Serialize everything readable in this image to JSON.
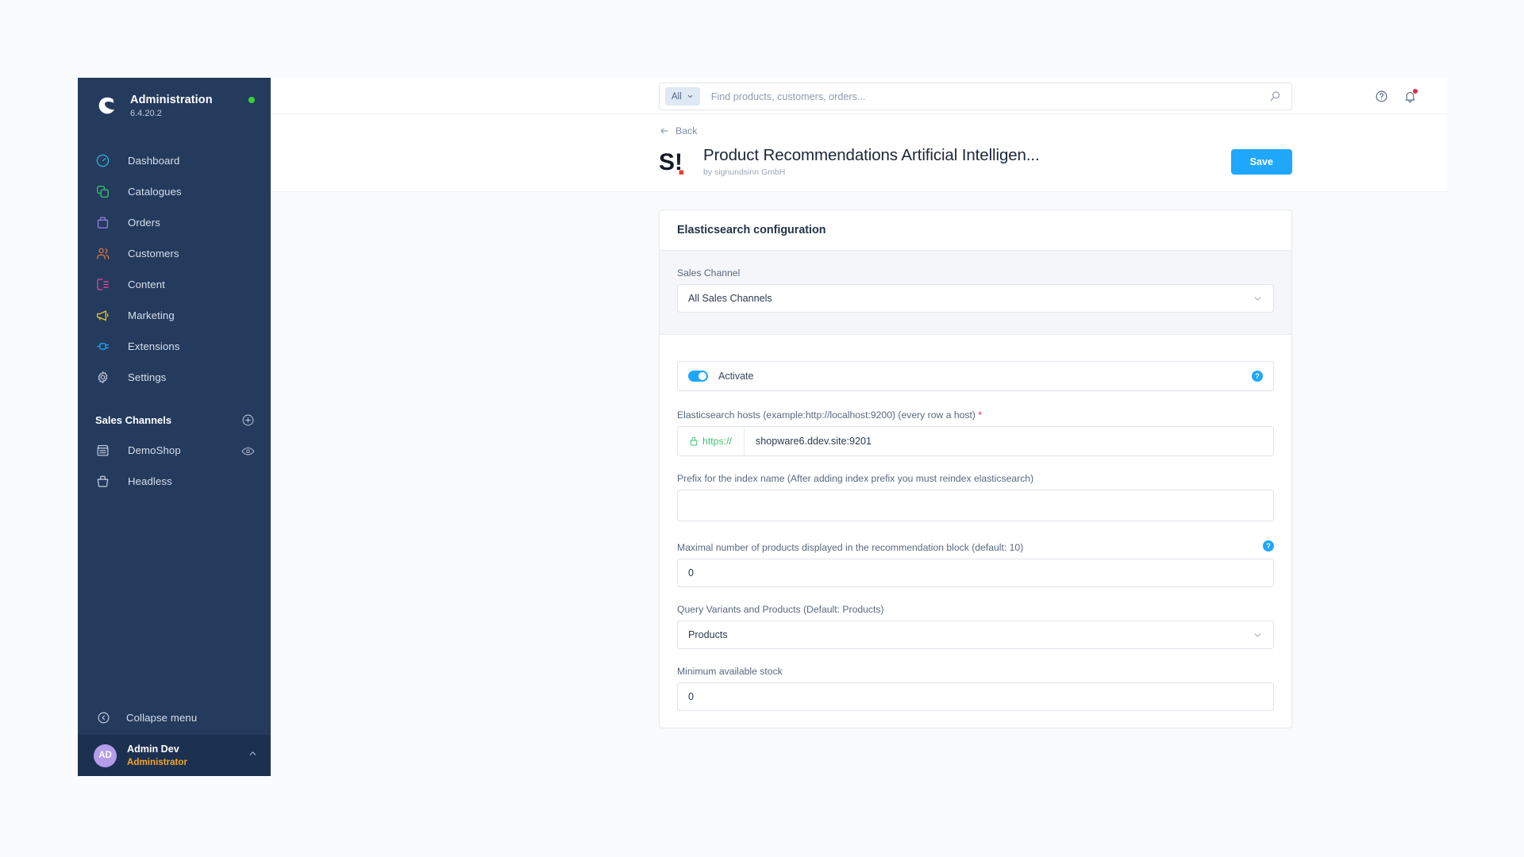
{
  "sidebar": {
    "brand": {
      "title": "Administration",
      "version": "6.4.20.2"
    },
    "nav": [
      {
        "label": "Dashboard",
        "icon": "speedometer-icon"
      },
      {
        "label": "Catalogues",
        "icon": "layers-icon"
      },
      {
        "label": "Orders",
        "icon": "bag-icon"
      },
      {
        "label": "Customers",
        "icon": "users-icon"
      },
      {
        "label": "Content",
        "icon": "content-icon"
      },
      {
        "label": "Marketing",
        "icon": "megaphone-icon"
      },
      {
        "label": "Extensions",
        "icon": "plug-icon"
      },
      {
        "label": "Settings",
        "icon": "gear-icon"
      }
    ],
    "sales_channels": {
      "label": "Sales Channels",
      "add_icon": "plus-circle-icon",
      "items": [
        {
          "label": "DemoShop",
          "icon": "storefront-icon",
          "action_icon": "eye-icon"
        },
        {
          "label": "Headless",
          "icon": "basket-icon"
        }
      ]
    },
    "collapse": {
      "label": "Collapse menu",
      "icon": "collapse-icon"
    },
    "user": {
      "initials": "AD",
      "name": "Admin Dev",
      "role": "Administrator"
    }
  },
  "topbar": {
    "scope": "All",
    "search_placeholder": "Find products, customers, orders...",
    "search_value": "",
    "help_icon": "help-circle-icon",
    "notifications_icon": "bell-icon"
  },
  "page": {
    "back_label": "Back",
    "title": "Product Recommendations Artificial Intelligen...",
    "vendor": "by signundsinn GmbH",
    "save_label": "Save"
  },
  "card": {
    "heading": "Elasticsearch configuration",
    "sales_channel": {
      "label": "Sales Channel",
      "value": "All Sales Channels"
    },
    "activate": {
      "label": "Activate",
      "enabled": true,
      "help": "?"
    },
    "hosts": {
      "label": "Elasticsearch hosts (example:http://localhost:9200) (every row a host)",
      "required": true,
      "prefix": "https://",
      "prefix_icon": "lock-icon",
      "value": "shopware6.ddev.site:9201"
    },
    "index_prefix": {
      "label": "Prefix for the index name (After adding index prefix you must reindex elasticsearch)",
      "value": ""
    },
    "max_products": {
      "label": "Maximal number of products displayed in the recommendation block (default: 10)",
      "value": "0",
      "help": "?"
    },
    "query_variants": {
      "label": "Query Variants and Products (Default: Products)",
      "value": "Products"
    },
    "min_stock": {
      "label": "Minimum available stock",
      "value": "0"
    }
  },
  "colors": {
    "sidebar_bg": "#243b5e",
    "accent": "#1fa7fb",
    "status_online": "#37d039",
    "role_text": "#f5a623",
    "notification": "#e52a4a",
    "secure_green": "#3ec46d"
  }
}
